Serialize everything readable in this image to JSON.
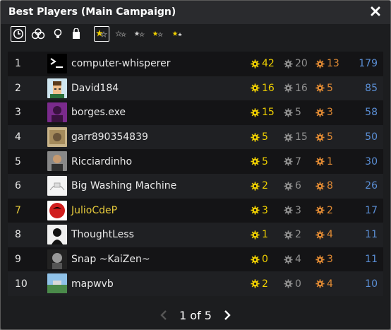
{
  "window": {
    "title": "Best Players (Main Campaign)"
  },
  "toolbar": {
    "icons": [
      "clock-icon",
      "dice-icon",
      "lightbulb-icon",
      "shopping-bag-icon",
      "half-star-icon",
      "one-star-icon",
      "two-stars-icon",
      "three-stars-icon",
      "four-stars-icon"
    ],
    "colors": {
      "star": "#f0d000",
      "star_dim": "#666666"
    }
  },
  "players": [
    {
      "rank": "1",
      "name": "computer-whisperer",
      "gold": "42",
      "silver": "20",
      "bronze": "13",
      "total": "179",
      "highlight": false
    },
    {
      "rank": "2",
      "name": "David184",
      "gold": "16",
      "silver": "16",
      "bronze": "5",
      "total": "85",
      "highlight": false
    },
    {
      "rank": "3",
      "name": "borges.exe",
      "gold": "15",
      "silver": "5",
      "bronze": "3",
      "total": "58",
      "highlight": false
    },
    {
      "rank": "4",
      "name": "garr890354839",
      "gold": "5",
      "silver": "15",
      "bronze": "5",
      "total": "50",
      "highlight": false
    },
    {
      "rank": "5",
      "name": "Ricciardinho",
      "gold": "5",
      "silver": "7",
      "bronze": "1",
      "total": "30",
      "highlight": false
    },
    {
      "rank": "6",
      "name": "Big Washing Machine",
      "gold": "2",
      "silver": "6",
      "bronze": "8",
      "total": "26",
      "highlight": false
    },
    {
      "rank": "7",
      "name": "JulioCdeP",
      "gold": "3",
      "silver": "3",
      "bronze": "2",
      "total": "17",
      "highlight": true
    },
    {
      "rank": "8",
      "name": "ThoughtLess",
      "gold": "1",
      "silver": "2",
      "bronze": "4",
      "total": "11",
      "highlight": false
    },
    {
      "rank": "9",
      "name": "Snap ~KaiZen~",
      "gold": "0",
      "silver": "4",
      "bronze": "3",
      "total": "11",
      "highlight": false
    },
    {
      "rank": "10",
      "name": "mapwvb",
      "gold": "2",
      "silver": "0",
      "bronze": "4",
      "total": "10",
      "highlight": false
    }
  ],
  "pagination": {
    "label": "1 of 5"
  },
  "colors": {
    "gold": "#f0d000",
    "silver": "#8f8f8f",
    "bronze": "#e08a34",
    "total": "#5b8fd6",
    "highlight": "#e5c93b"
  }
}
